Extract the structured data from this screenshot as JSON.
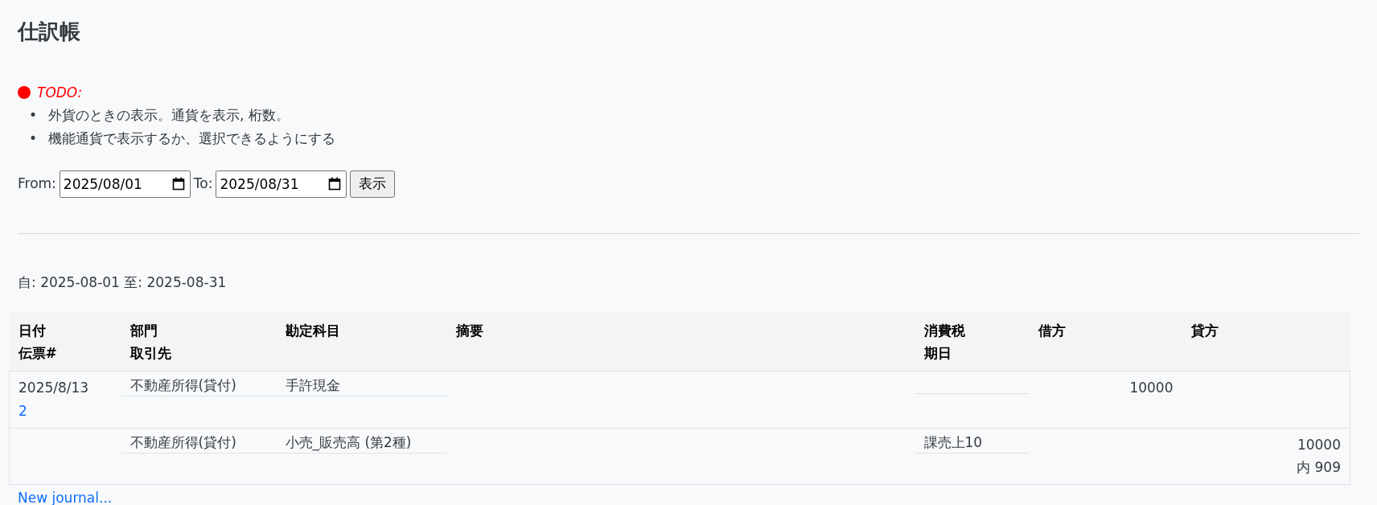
{
  "title": "仕訳帳",
  "todo": {
    "label": "TODO:",
    "marker": "•",
    "items": [
      "外貨のときの表示。通貨を表示, 桁数。",
      "機能通貨で表示するか、選択できるようにする"
    ]
  },
  "filter": {
    "from_label": "From:",
    "from": "2025/08/01",
    "to_label": "To:",
    "to": "2025/08/31",
    "button": "表示"
  },
  "range": "自: 2025-08-01 至: 2025-08-31",
  "table": {
    "columns": [
      {
        "top": "日付",
        "bottom": "伝票#"
      },
      {
        "top": "部門",
        "bottom": "取引先"
      },
      {
        "top": "勘定科目"
      },
      {
        "top": "摘要"
      },
      {
        "top": "消費税",
        "bottom": "期日"
      },
      {
        "top": "借方"
      },
      {
        "top": "貸方"
      }
    ],
    "rows": [
      {
        "date": "2025/8/13",
        "voucher": "2",
        "department": "不動産所得(貸付)",
        "account": "手許現金",
        "debit": "10000"
      },
      {
        "department": "不動産所得(貸付)",
        "account": "小売_販売高 (第2種)",
        "tax": "課売上10",
        "credit": "10000",
        "credit_tax": "内 909"
      }
    ]
  },
  "new_link": "New journal..."
}
